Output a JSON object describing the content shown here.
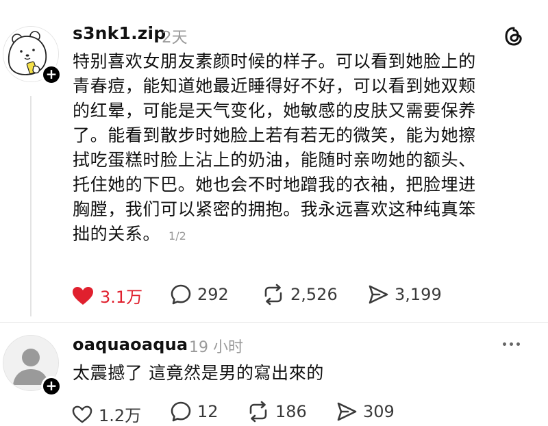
{
  "post": {
    "username": "s3nk1.zip",
    "timestamp": "2天",
    "lines": [
      "特别喜欢女朋友素颜时候的样子。可以看到她脸上的",
      "青春痘，能知道她最近睡得好不好，可以看到她双颊",
      "的红晕，可能是天气变化，她敏感的皮肤又需要保养",
      "了。能看到散步时她脸上若有若无的微笑，能为她擦",
      "拭吃蛋糕时脸上沾上的奶油，能随时亲吻她的额头、",
      "托住她的下巴。她也会不时地蹭我的衣袖，把脸埋进",
      "胸膛，我们可以紧密的拥抱。我永远喜欢这种纯真笨",
      "拙的关系。"
    ],
    "page_indicator": "1/2",
    "likes": "3.1万",
    "replies": "292",
    "reposts": "2,526",
    "shares": "3,199",
    "liked": true,
    "accent_color": "#e0202e"
  },
  "reply": {
    "username": "oaquaoaqua",
    "timestamp": "19 小时",
    "text": "太震撼了 這竟然是男的寫出來的",
    "likes": "1.2万",
    "replies": "12",
    "reposts": "186",
    "shares": "309"
  },
  "icons": {
    "follow": "+",
    "logo": "threads-logo-icon",
    "like": "heart-icon",
    "reply": "comment-bubble-icon",
    "repost": "repost-arrows-icon",
    "share": "send-icon",
    "more": "more-dots-icon"
  }
}
